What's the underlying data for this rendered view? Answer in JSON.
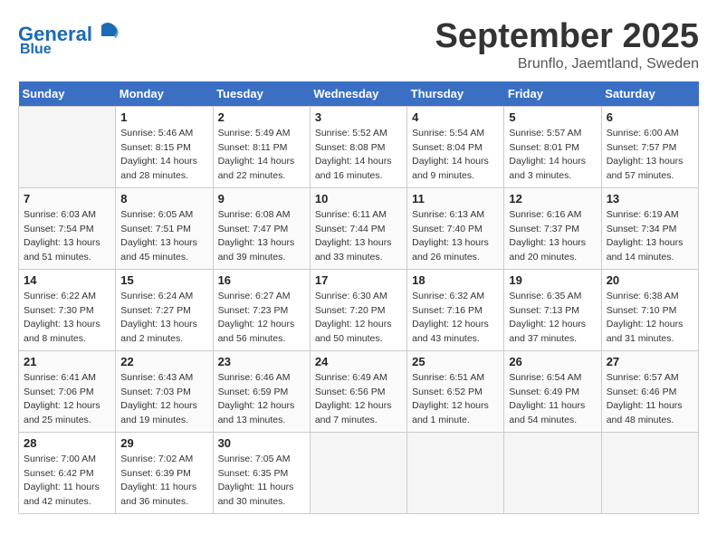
{
  "logo": {
    "text_general": "General",
    "text_blue": "Blue"
  },
  "title": "September 2025",
  "subtitle": "Brunflo, Jaemtland, Sweden",
  "days_of_week": [
    "Sunday",
    "Monday",
    "Tuesday",
    "Wednesday",
    "Thursday",
    "Friday",
    "Saturday"
  ],
  "weeks": [
    [
      {
        "num": "",
        "info": ""
      },
      {
        "num": "1",
        "info": "Sunrise: 5:46 AM\nSunset: 8:15 PM\nDaylight: 14 hours\nand 28 minutes."
      },
      {
        "num": "2",
        "info": "Sunrise: 5:49 AM\nSunset: 8:11 PM\nDaylight: 14 hours\nand 22 minutes."
      },
      {
        "num": "3",
        "info": "Sunrise: 5:52 AM\nSunset: 8:08 PM\nDaylight: 14 hours\nand 16 minutes."
      },
      {
        "num": "4",
        "info": "Sunrise: 5:54 AM\nSunset: 8:04 PM\nDaylight: 14 hours\nand 9 minutes."
      },
      {
        "num": "5",
        "info": "Sunrise: 5:57 AM\nSunset: 8:01 PM\nDaylight: 14 hours\nand 3 minutes."
      },
      {
        "num": "6",
        "info": "Sunrise: 6:00 AM\nSunset: 7:57 PM\nDaylight: 13 hours\nand 57 minutes."
      }
    ],
    [
      {
        "num": "7",
        "info": "Sunrise: 6:03 AM\nSunset: 7:54 PM\nDaylight: 13 hours\nand 51 minutes."
      },
      {
        "num": "8",
        "info": "Sunrise: 6:05 AM\nSunset: 7:51 PM\nDaylight: 13 hours\nand 45 minutes."
      },
      {
        "num": "9",
        "info": "Sunrise: 6:08 AM\nSunset: 7:47 PM\nDaylight: 13 hours\nand 39 minutes."
      },
      {
        "num": "10",
        "info": "Sunrise: 6:11 AM\nSunset: 7:44 PM\nDaylight: 13 hours\nand 33 minutes."
      },
      {
        "num": "11",
        "info": "Sunrise: 6:13 AM\nSunset: 7:40 PM\nDaylight: 13 hours\nand 26 minutes."
      },
      {
        "num": "12",
        "info": "Sunrise: 6:16 AM\nSunset: 7:37 PM\nDaylight: 13 hours\nand 20 minutes."
      },
      {
        "num": "13",
        "info": "Sunrise: 6:19 AM\nSunset: 7:34 PM\nDaylight: 13 hours\nand 14 minutes."
      }
    ],
    [
      {
        "num": "14",
        "info": "Sunrise: 6:22 AM\nSunset: 7:30 PM\nDaylight: 13 hours\nand 8 minutes."
      },
      {
        "num": "15",
        "info": "Sunrise: 6:24 AM\nSunset: 7:27 PM\nDaylight: 13 hours\nand 2 minutes."
      },
      {
        "num": "16",
        "info": "Sunrise: 6:27 AM\nSunset: 7:23 PM\nDaylight: 12 hours\nand 56 minutes."
      },
      {
        "num": "17",
        "info": "Sunrise: 6:30 AM\nSunset: 7:20 PM\nDaylight: 12 hours\nand 50 minutes."
      },
      {
        "num": "18",
        "info": "Sunrise: 6:32 AM\nSunset: 7:16 PM\nDaylight: 12 hours\nand 43 minutes."
      },
      {
        "num": "19",
        "info": "Sunrise: 6:35 AM\nSunset: 7:13 PM\nDaylight: 12 hours\nand 37 minutes."
      },
      {
        "num": "20",
        "info": "Sunrise: 6:38 AM\nSunset: 7:10 PM\nDaylight: 12 hours\nand 31 minutes."
      }
    ],
    [
      {
        "num": "21",
        "info": "Sunrise: 6:41 AM\nSunset: 7:06 PM\nDaylight: 12 hours\nand 25 minutes."
      },
      {
        "num": "22",
        "info": "Sunrise: 6:43 AM\nSunset: 7:03 PM\nDaylight: 12 hours\nand 19 minutes."
      },
      {
        "num": "23",
        "info": "Sunrise: 6:46 AM\nSunset: 6:59 PM\nDaylight: 12 hours\nand 13 minutes."
      },
      {
        "num": "24",
        "info": "Sunrise: 6:49 AM\nSunset: 6:56 PM\nDaylight: 12 hours\nand 7 minutes."
      },
      {
        "num": "25",
        "info": "Sunrise: 6:51 AM\nSunset: 6:52 PM\nDaylight: 12 hours\nand 1 minute."
      },
      {
        "num": "26",
        "info": "Sunrise: 6:54 AM\nSunset: 6:49 PM\nDaylight: 11 hours\nand 54 minutes."
      },
      {
        "num": "27",
        "info": "Sunrise: 6:57 AM\nSunset: 6:46 PM\nDaylight: 11 hours\nand 48 minutes."
      }
    ],
    [
      {
        "num": "28",
        "info": "Sunrise: 7:00 AM\nSunset: 6:42 PM\nDaylight: 11 hours\nand 42 minutes."
      },
      {
        "num": "29",
        "info": "Sunrise: 7:02 AM\nSunset: 6:39 PM\nDaylight: 11 hours\nand 36 minutes."
      },
      {
        "num": "30",
        "info": "Sunrise: 7:05 AM\nSunset: 6:35 PM\nDaylight: 11 hours\nand 30 minutes."
      },
      {
        "num": "",
        "info": ""
      },
      {
        "num": "",
        "info": ""
      },
      {
        "num": "",
        "info": ""
      },
      {
        "num": "",
        "info": ""
      }
    ]
  ]
}
